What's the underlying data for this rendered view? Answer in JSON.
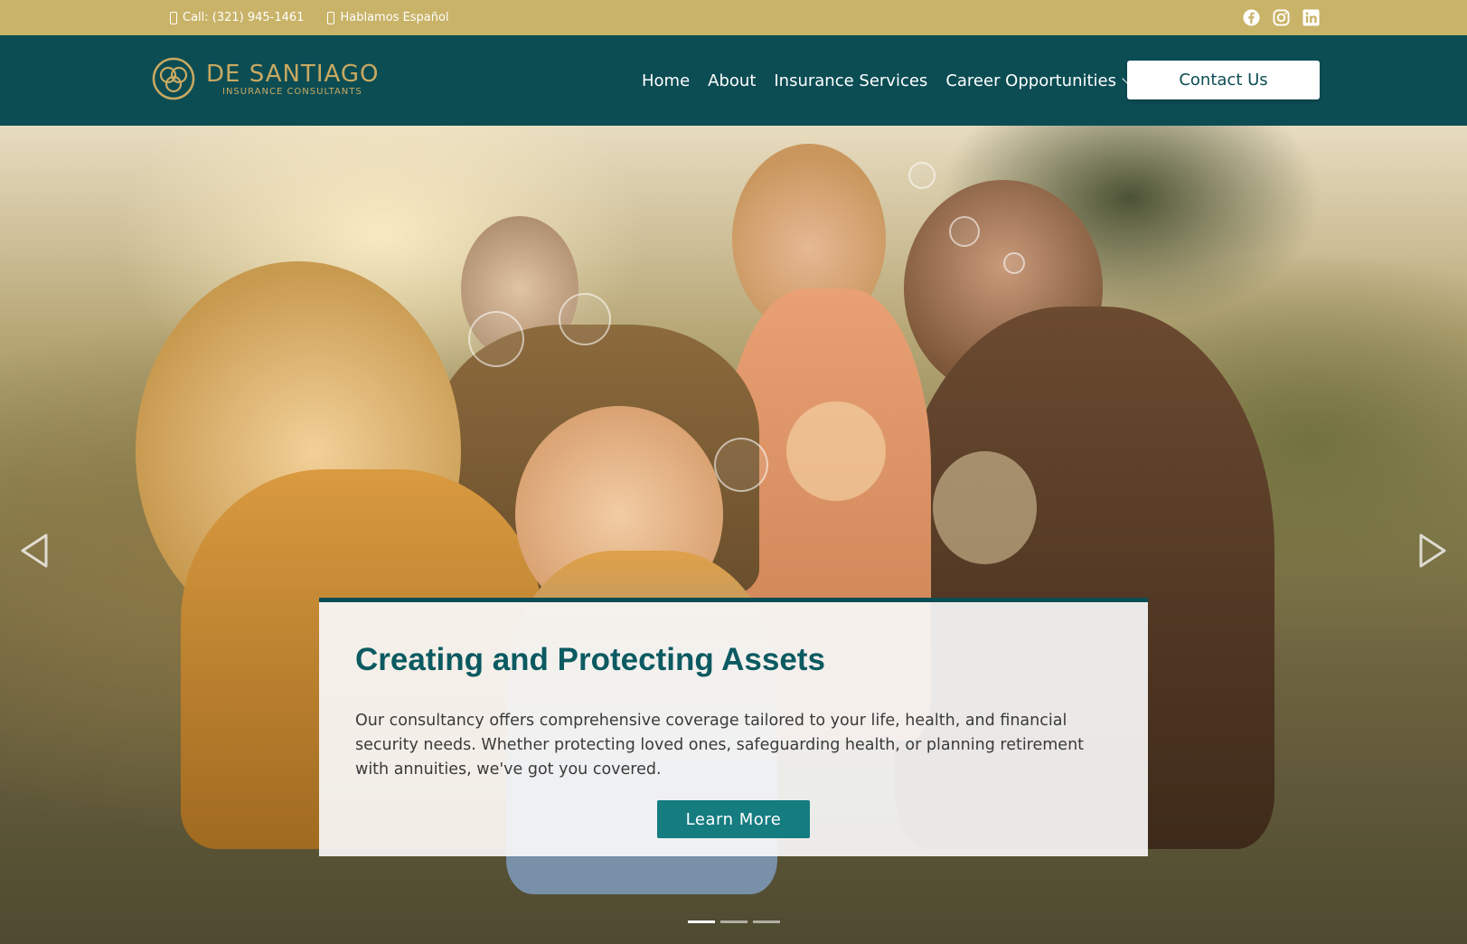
{
  "topbar": {
    "phone_text": "Call: (321) 945-1461",
    "spanish_text": "Hablamos Español",
    "social": [
      "facebook-icon",
      "instagram-icon",
      "linkedin-icon"
    ]
  },
  "header": {
    "logo_name": "DE SANTIAGO",
    "logo_subtitle": "INSURANCE CONSULTANTS",
    "nav": {
      "home": "Home",
      "about": "About",
      "insurance": "Insurance Services",
      "career": "Career Opportunities"
    },
    "contact_label": "Contact Us"
  },
  "hero": {
    "title": "Creating and Protecting Assets",
    "description": "Our consultancy offers comprehensive coverage tailored to your life, health, and financial security needs. Whether protecting loved ones, safeguarding health, or planning retirement with annuities, we've got you covered.",
    "cta_label": "Learn More",
    "slides_total": 3,
    "active_slide": 1
  },
  "colors": {
    "topbar": "#c9b368",
    "header": "#0c4d54",
    "accent_gold": "#c9a961",
    "title": "#0c5a61",
    "button": "#157c80"
  }
}
